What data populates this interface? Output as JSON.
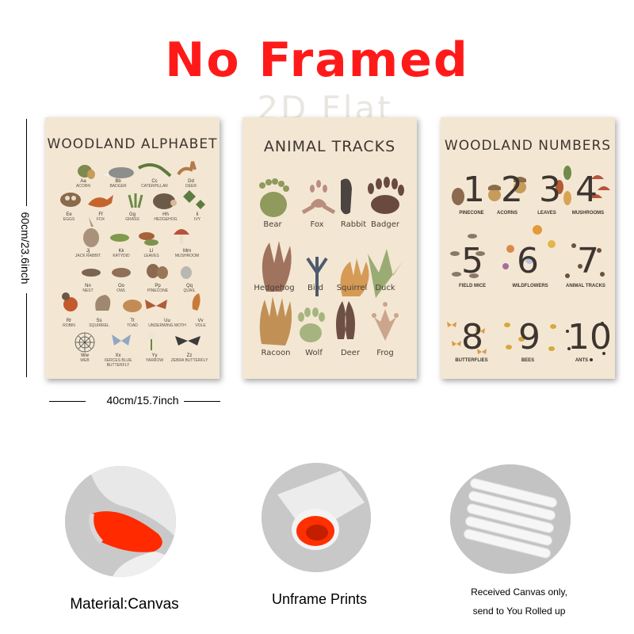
{
  "headline": "No Framed",
  "watermark": "2D Flat",
  "dimensions": {
    "height": "60cm/23.6inch",
    "width": "40cm/15.7inch"
  },
  "posters": {
    "alphabet": {
      "title": "WOODLAND ALPHABET",
      "rows": [
        [
          {
            "letters": "Aa",
            "word": "ACORN"
          },
          {
            "letters": "Bb",
            "word": "BADGER"
          },
          {
            "letters": "Cc",
            "word": "CATERPILLAR"
          },
          {
            "letters": "Dd",
            "word": "DEER"
          }
        ],
        [
          {
            "letters": "Ee",
            "word": "EGGS"
          },
          {
            "letters": "Ff",
            "word": "FOX"
          },
          {
            "letters": "Gg",
            "word": "GRASS"
          },
          {
            "letters": "Hh",
            "word": "HEDGEHOG"
          },
          {
            "letters": "Ii",
            "word": "IVY"
          }
        ],
        [
          {
            "letters": "Jj",
            "word": "JACK RABBIT"
          },
          {
            "letters": "Kk",
            "word": "KATYDID"
          },
          {
            "letters": "Ll",
            "word": "LEAVES"
          },
          {
            "letters": "Mm",
            "word": "MUSHROOM"
          }
        ],
        [
          {
            "letters": "Nn",
            "word": "NEST"
          },
          {
            "letters": "Oo",
            "word": "OWL"
          },
          {
            "letters": "Pp",
            "word": "PINECONE"
          },
          {
            "letters": "Qq",
            "word": "QUAIL"
          }
        ],
        [
          {
            "letters": "Rr",
            "word": "ROBIN"
          },
          {
            "letters": "Ss",
            "word": "SQUIRREL"
          },
          {
            "letters": "Tt",
            "word": "TOAD"
          },
          {
            "letters": "Uu",
            "word": "UNDERWING MOTH"
          },
          {
            "letters": "Vv",
            "word": "VOLE"
          }
        ],
        [
          {
            "letters": "Ww",
            "word": "WEB"
          },
          {
            "letters": "Xx",
            "word": "XERCES BLUE BUTTERFLY"
          },
          {
            "letters": "Yy",
            "word": "YARROW"
          },
          {
            "letters": "Zz",
            "word": "ZEBRA BUTTERFLY"
          }
        ]
      ]
    },
    "tracks": {
      "title": "ANIMAL TRACKS",
      "items": [
        "Bear",
        "Fox",
        "Rabbit",
        "Badger",
        "Hedgehog",
        "Bird",
        "Squirrel",
        "Duck",
        "Racoon",
        "Wolf",
        "Deer",
        "Frog"
      ]
    },
    "numbers": {
      "title": "WOODLAND NUMBERS",
      "items": [
        {
          "number": "1",
          "label": "PINECONE"
        },
        {
          "number": "2",
          "label": "ACORNS"
        },
        {
          "number": "3",
          "label": "LEAVES"
        },
        {
          "number": "4",
          "label": "MUSHROOMS"
        },
        {
          "number": "5",
          "label": "FIELD MICE"
        },
        {
          "number": "6",
          "label": "WILDFLOWERS"
        },
        {
          "number": "7",
          "label": "ANIMAL TRACKS"
        },
        {
          "number": "8",
          "label": "BUTTERFLIES"
        },
        {
          "number": "9",
          "label": "BEES"
        },
        {
          "number": "10",
          "label": "ANTS"
        }
      ]
    }
  },
  "features": [
    {
      "caption": "Material:Canvas"
    },
    {
      "caption": "Unframe  Prints"
    },
    {
      "caption_line1": "Received Canvas only,",
      "caption_line2": "send to You Rolled up"
    }
  ],
  "colors": {
    "headline": "#ff1a1a",
    "poster_bg": "#f3e7d3",
    "canvas_inner": "#ff2a00"
  }
}
